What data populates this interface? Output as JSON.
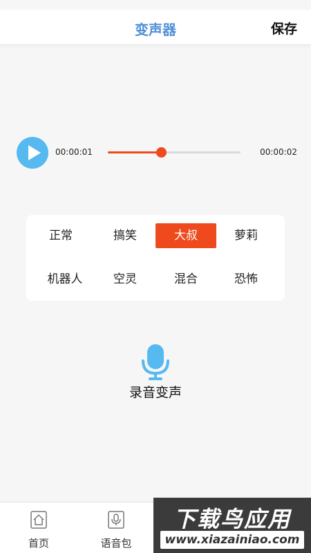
{
  "header": {
    "title": "变声器",
    "save_label": "保存"
  },
  "player": {
    "current_time": "00:00:01",
    "duration": "00:00:02",
    "progress": 0.4
  },
  "effects": {
    "items": [
      "正常",
      "搞笑",
      "大叔",
      "萝莉",
      "机器人",
      "空灵",
      "混合",
      "恐怖"
    ],
    "selected": "大叔"
  },
  "record": {
    "label": "录音变声"
  },
  "tabbar": {
    "items": [
      {
        "label": "首页"
      },
      {
        "label": "语音包"
      }
    ]
  },
  "watermark": {
    "title": "下载鸟应用",
    "url": "www.xiazainiao.com"
  },
  "colors": {
    "accent": "#ee4a1d",
    "title_blue": "#4f8fd8",
    "mic_blue": "#56b9ef"
  }
}
